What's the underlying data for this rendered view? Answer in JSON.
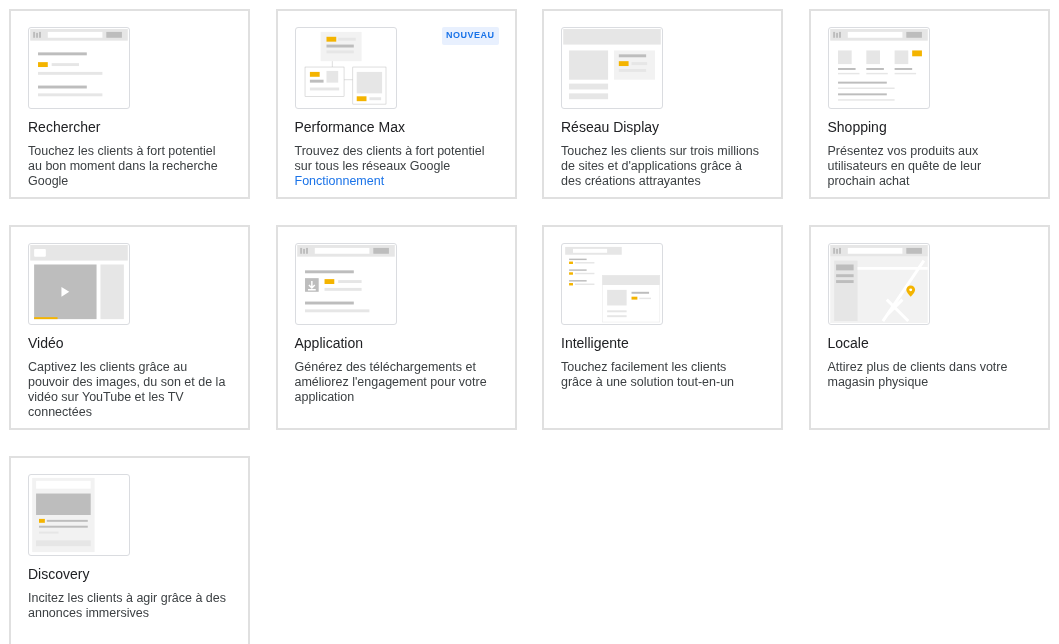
{
  "campaign_types": [
    {
      "kind": "search",
      "title": "Rechercher",
      "description": "Touchez les clients à fort potentiel au bon moment dans la recherche Google"
    },
    {
      "kind": "performance",
      "title": "Performance Max",
      "badge": "NOUVEAU",
      "description": "Trouvez des clients à fort potentiel sur tous les réseaux Google",
      "link": "Fonctionnement"
    },
    {
      "kind": "display",
      "title": "Réseau Display",
      "description": "Touchez les clients sur trois millions de sites et d'applications grâce à des créations attrayantes"
    },
    {
      "kind": "shopping",
      "title": "Shopping",
      "description": "Présentez vos produits aux utilisateurs en quête de leur prochain achat"
    },
    {
      "kind": "video",
      "title": "Vidéo",
      "description": "Captivez les clients grâce au pouvoir des images, du son et de la vidéo sur YouTube et les TV connectées"
    },
    {
      "kind": "app",
      "title": "Application",
      "description": "Générez des téléchargements et améliorez l'engagement pour votre application"
    },
    {
      "kind": "smart",
      "title": "Intelligente",
      "description": "Touchez facilement les clients grâce à une solution tout-en-un"
    },
    {
      "kind": "local",
      "title": "Locale",
      "description": "Attirez plus de clients dans votre magasin physique"
    },
    {
      "kind": "discovery",
      "title": "Discovery",
      "description": "Incitez les clients à agir grâce à des annonces immersives"
    }
  ]
}
